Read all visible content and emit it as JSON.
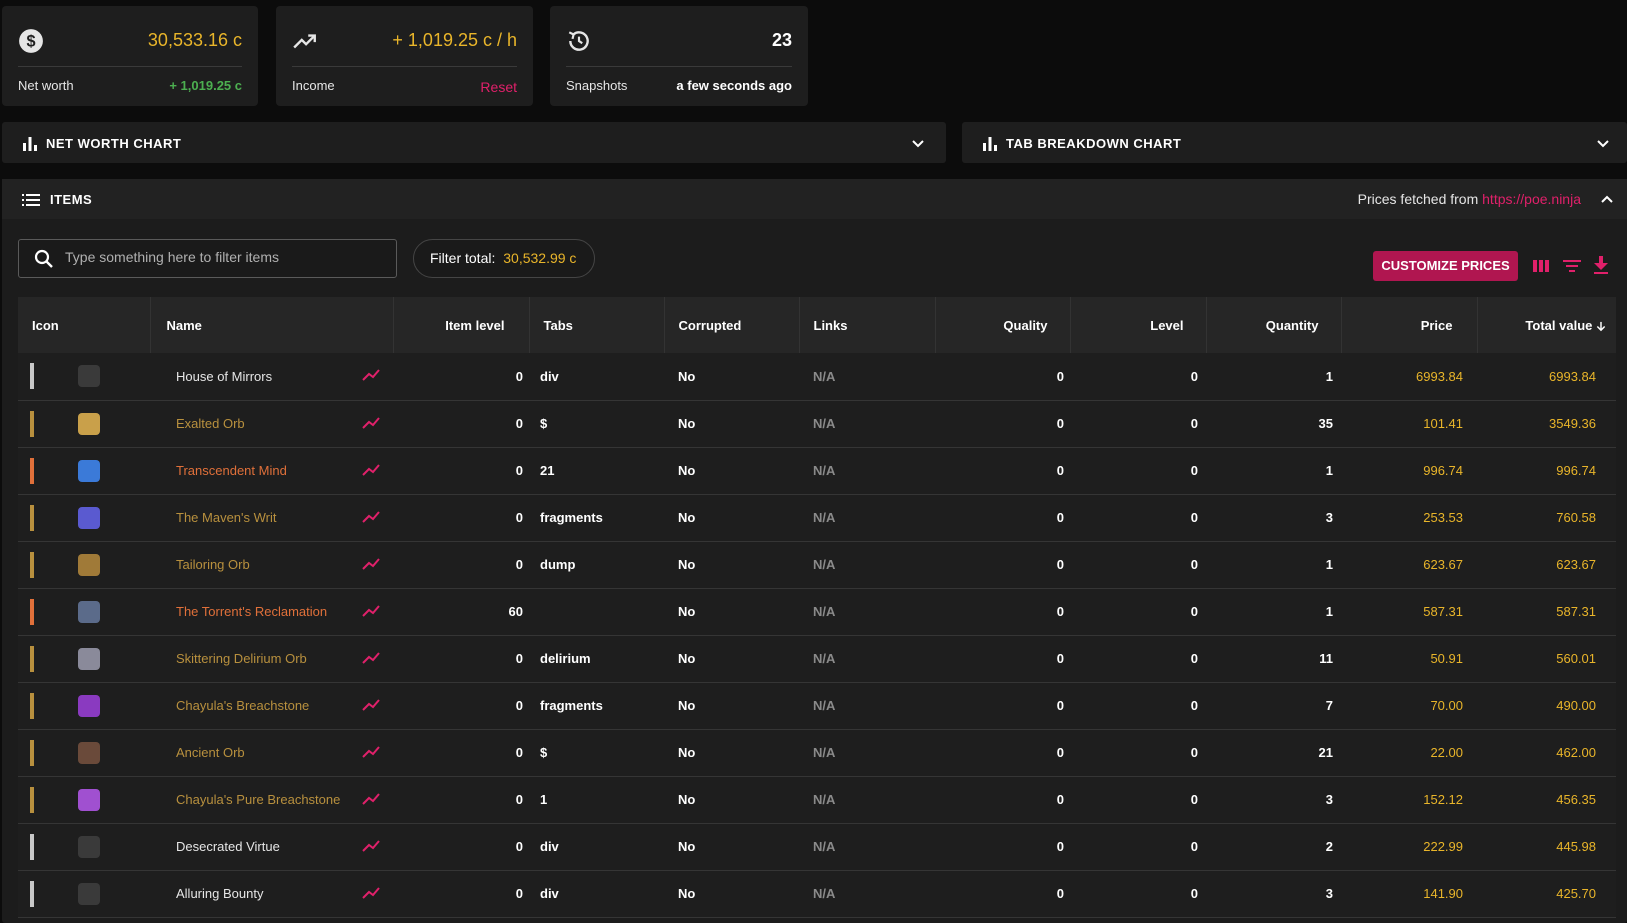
{
  "stats": {
    "net_worth": {
      "value": "30,533.16 c",
      "label": "Net worth",
      "change": "+ 1,019.25 c"
    },
    "income": {
      "value": "+ 1,019.25 c / h",
      "label": "Income",
      "action": "Reset"
    },
    "snapshots": {
      "value": "23",
      "label": "Snapshots",
      "updated": "a few seconds ago"
    }
  },
  "charts": {
    "net_worth_title": "NET WORTH CHART",
    "tab_breakdown_title": "TAB BREAKDOWN CHART"
  },
  "items_panel": {
    "title": "ITEMS",
    "prices_prefix": "Prices fetched from ",
    "prices_link": "https://poe.ninja",
    "search_placeholder": "Type something here to filter items",
    "filter_total_label": "Filter total:",
    "filter_total_value": "30,532.99 c",
    "customize_label": "CUSTOMIZE PRICES"
  },
  "table": {
    "headers": {
      "icon": "Icon",
      "name": "Name",
      "item_level": "Item level",
      "tabs": "Tabs",
      "corrupted": "Corrupted",
      "links": "Links",
      "quality": "Quality",
      "level": "Level",
      "quantity": "Quantity",
      "price": "Price",
      "total": "Total value"
    },
    "rows": [
      {
        "name": "House of Mirrors",
        "ilvl": "0",
        "tabs": "div",
        "corrupted": "No",
        "links": "N/A",
        "quality": "0",
        "level": "0",
        "qty": "1",
        "price": "6993.84",
        "total": "6993.84"
      },
      {
        "name": "Exalted Orb",
        "ilvl": "0",
        "tabs": "$",
        "corrupted": "No",
        "links": "N/A",
        "quality": "0",
        "level": "0",
        "qty": "35",
        "price": "101.41",
        "total": "3549.36"
      },
      {
        "name": "Transcendent Mind",
        "ilvl": "0",
        "tabs": "21",
        "corrupted": "No",
        "links": "N/A",
        "quality": "0",
        "level": "0",
        "qty": "1",
        "price": "996.74",
        "total": "996.74"
      },
      {
        "name": "The Maven's Writ",
        "ilvl": "0",
        "tabs": "fragments",
        "corrupted": "No",
        "links": "N/A",
        "quality": "0",
        "level": "0",
        "qty": "3",
        "price": "253.53",
        "total": "760.58"
      },
      {
        "name": "Tailoring Orb",
        "ilvl": "0",
        "tabs": "dump",
        "corrupted": "No",
        "links": "N/A",
        "quality": "0",
        "level": "0",
        "qty": "1",
        "price": "623.67",
        "total": "623.67"
      },
      {
        "name": "The Torrent's Reclamation",
        "ilvl": "60",
        "tabs": "",
        "corrupted": "No",
        "links": "N/A",
        "quality": "0",
        "level": "0",
        "qty": "1",
        "price": "587.31",
        "total": "587.31"
      },
      {
        "name": "Skittering Delirium Orb",
        "ilvl": "0",
        "tabs": "delirium",
        "corrupted": "No",
        "links": "N/A",
        "quality": "0",
        "level": "0",
        "qty": "11",
        "price": "50.91",
        "total": "560.01"
      },
      {
        "name": "Chayula's Breachstone",
        "ilvl": "0",
        "tabs": "fragments",
        "corrupted": "No",
        "links": "N/A",
        "quality": "0",
        "level": "0",
        "qty": "7",
        "price": "70.00",
        "total": "490.00"
      },
      {
        "name": "Ancient Orb",
        "ilvl": "0",
        "tabs": "$",
        "corrupted": "No",
        "links": "N/A",
        "quality": "0",
        "level": "0",
        "qty": "21",
        "price": "22.00",
        "total": "462.00"
      },
      {
        "name": "Chayula's Pure Breachstone",
        "ilvl": "0",
        "tabs": "1",
        "corrupted": "No",
        "links": "N/A",
        "quality": "0",
        "level": "0",
        "qty": "3",
        "price": "152.12",
        "total": "456.35"
      },
      {
        "name": "Desecrated Virtue",
        "ilvl": "0",
        "tabs": "div",
        "corrupted": "No",
        "links": "N/A",
        "quality": "0",
        "level": "0",
        "qty": "2",
        "price": "222.99",
        "total": "445.98"
      },
      {
        "name": "Alluring Bounty",
        "ilvl": "0",
        "tabs": "div",
        "corrupted": "No",
        "links": "N/A",
        "quality": "0",
        "level": "0",
        "qty": "3",
        "price": "141.90",
        "total": "425.70"
      }
    ]
  },
  "colors": {
    "accent": "#e0206a",
    "gold": "#e9b52a",
    "green": "#4caf50",
    "rarity_white": "#c8c8c8",
    "rarity_currency": "#b8903e",
    "rarity_unique": "#e0703a"
  },
  "icons": [
    "dollar-icon",
    "trending-up-icon",
    "history-icon",
    "bar-chart-icon",
    "chevron-down-icon",
    "list-icon",
    "chevron-up-icon",
    "search-icon",
    "columns-icon",
    "filter-icon",
    "download-icon",
    "arrow-down-icon"
  ]
}
